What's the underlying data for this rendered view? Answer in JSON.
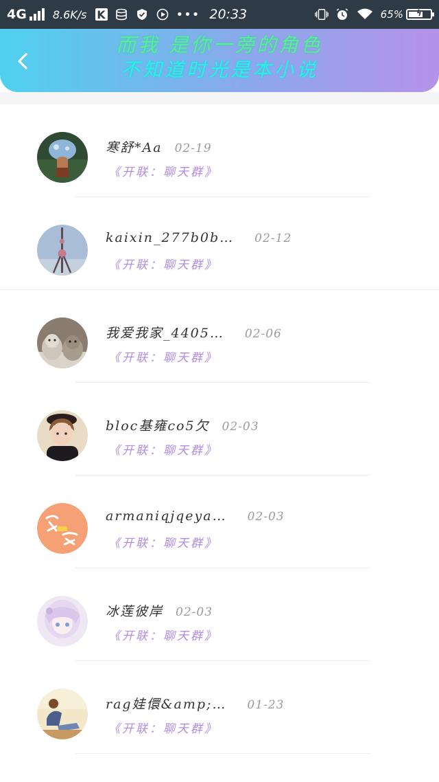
{
  "status_bar": {
    "network": "4G",
    "speed": "8.6K/s",
    "time": "20:33",
    "battery_percent_text": "65%",
    "battery_level": 0.65,
    "icons": [
      "signal-icon",
      "k-app-icon",
      "data-icon",
      "shield-icon",
      "play-icon",
      "more-icon",
      "vibrate-icon",
      "alarm-icon",
      "wifi-icon",
      "battery-icon"
    ]
  },
  "header": {
    "back_icon": "chevron-left-icon",
    "title_line1": "而我 是你一旁的角色",
    "title_line2": "不知道时光是本小说",
    "gradient": [
      "#4fd1ee",
      "#b592ea"
    ]
  },
  "colors": {
    "group_text": "#b28be6",
    "date_text": "#9b9b9b",
    "name_text": "#333333"
  },
  "items": [
    {
      "name": "寒舒*Aa",
      "date": "02-19",
      "group": "《开联：聊天群》",
      "avatar": "avatar-mushroom-figure"
    },
    {
      "name": "kaixin_277b0b…",
      "date": "02-12",
      "group": "《开联：聊天群》",
      "avatar": "avatar-tv-tower"
    },
    {
      "name": "我爱我家_4405…",
      "date": "02-06",
      "group": "《开联：聊天群》",
      "avatar": "avatar-cats"
    },
    {
      "name": "bloc基雍co5欠",
      "date": "02-03",
      "group": "《开联：聊天群》",
      "avatar": "avatar-girl-hat"
    },
    {
      "name": "armaniqjqeya…",
      "date": "02-03",
      "group": "《开联：聊天群》",
      "avatar": "avatar-orange-badge"
    },
    {
      "name": "冰莲彼岸",
      "date": "02-03",
      "group": "《开联：聊天群》",
      "avatar": "avatar-anime-girl"
    },
    {
      "name": "rag娃儇&amp;…",
      "date": "01-23",
      "group": "《开联：聊天群》",
      "avatar": "avatar-sitting-girl"
    }
  ]
}
